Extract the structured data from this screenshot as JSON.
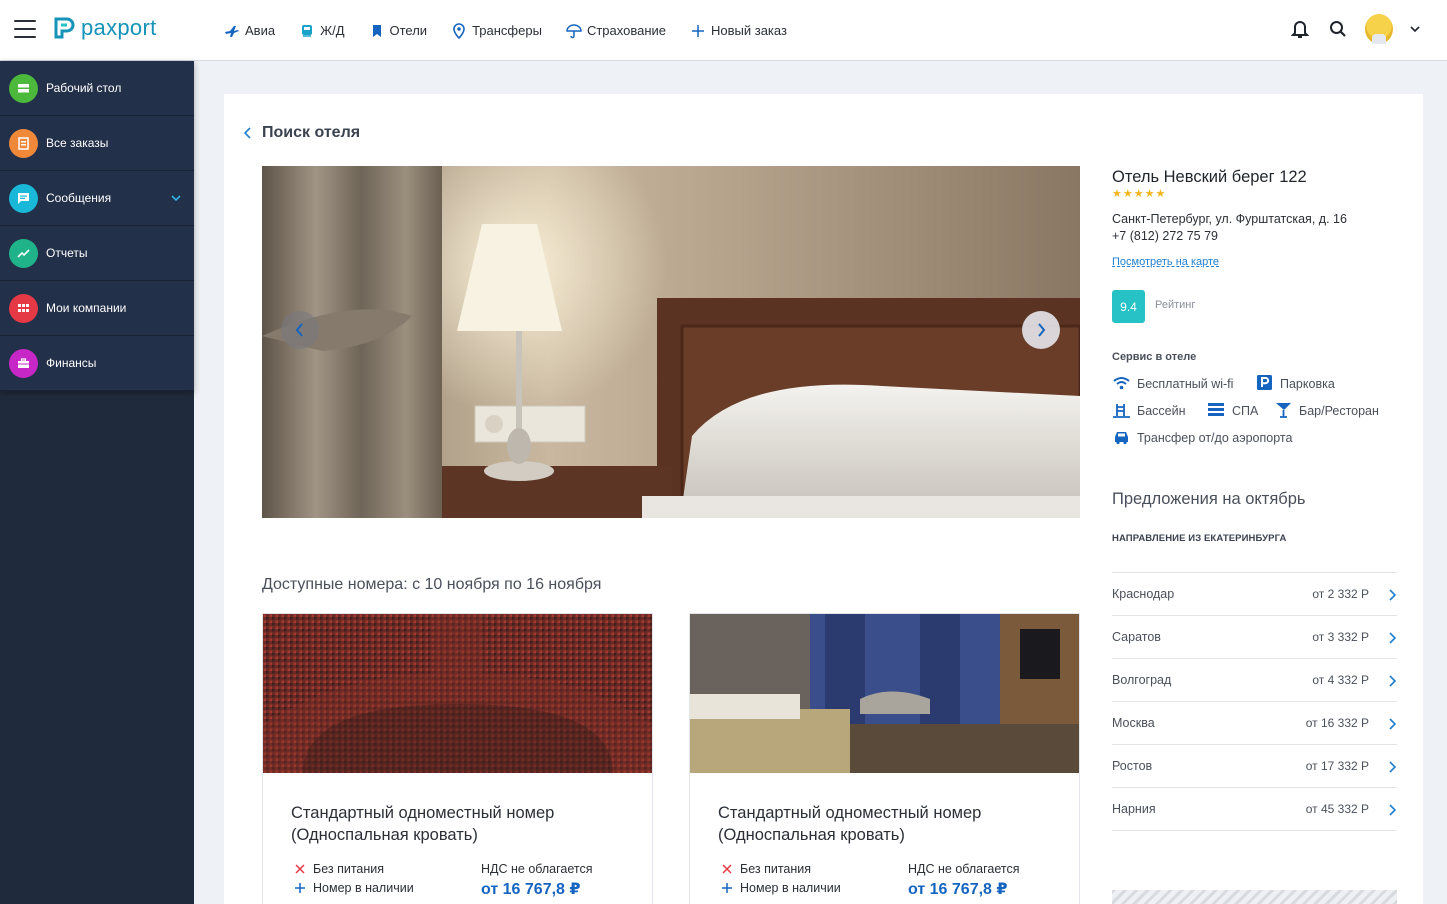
{
  "brand": {
    "name": "paxport",
    "accent": "#1593b8"
  },
  "topnav": [
    {
      "label": "Авиа",
      "icon": "plane-icon"
    },
    {
      "label": "Ж/Д",
      "icon": "train-icon"
    },
    {
      "label": "Отели",
      "icon": "bookmark-icon"
    },
    {
      "label": "Трансферы",
      "icon": "location-pin-icon"
    },
    {
      "label": "Страхование",
      "icon": "umbrella-icon"
    },
    {
      "label": "Новый заказ",
      "icon": "plus-icon"
    }
  ],
  "sidebar": {
    "items": [
      {
        "label": "Рабочий стол",
        "color": "#4cb83c",
        "icon": "desktop-icon"
      },
      {
        "label": "Все заказы",
        "color": "#f0883a",
        "icon": "orders-icon"
      },
      {
        "label": "Сообщения",
        "color": "#1ab8d8",
        "icon": "chat-icon"
      },
      {
        "label": "Отчеты",
        "color": "#20b38a",
        "icon": "chart-trend-icon"
      },
      {
        "label": "Мои компании",
        "color": "#e53945",
        "icon": "grid-icon"
      },
      {
        "label": "Финансы",
        "color": "#c727c7",
        "icon": "briefcase-icon"
      }
    ]
  },
  "page": {
    "back_label": "Поиск отеля",
    "rooms_title": "Доступные номера: с 10 ноября по 16 ноября"
  },
  "rooms": [
    {
      "name": "Стандартный одноместный номер (Односпальная кровать)",
      "feature_1": "Без питания",
      "feature_2": "Номер в наличии",
      "vat": "НДС не облагается",
      "price": "от 16 767,8 ₽"
    },
    {
      "name": "Стандартный одноместный номер (Односпальная кровать)",
      "feature_1": "Без питания",
      "feature_2": "Номер в наличии",
      "vat": "НДС не облагается",
      "price": "от 16 767,8 ₽"
    }
  ],
  "hotel": {
    "name": "Отель Невский берег 122",
    "stars": 5,
    "address": "Санкт-Петербург, ул. Фурштатская, д. 16",
    "phone": "+7 (812) 272 75 79",
    "map_link": "Посмотреть на карте",
    "rating": "9.4",
    "rating_label": "Рейтинг",
    "services_title": "Сервис в отеле",
    "services": [
      {
        "label": "Бесплатный wi-fi",
        "icon": "wifi-icon"
      },
      {
        "label": "Парковка",
        "icon": "parking-icon"
      },
      {
        "label": "Бассейн",
        "icon": "pool-icon"
      },
      {
        "label": "СПА",
        "icon": "spa-icon"
      },
      {
        "label": "Бар/Ресторан",
        "icon": "cocktail-icon"
      },
      {
        "label": "Трансфер от/до аэропорта",
        "icon": "car-icon"
      }
    ]
  },
  "offers": {
    "title": "Предложения на октябрь",
    "direction": "НАПРАВЛЕНИЕ ИЗ ЕКАТЕРИНБУРГА",
    "rows": [
      {
        "city": "Краснодар",
        "price": "от 2 332 Р"
      },
      {
        "city": "Саратов",
        "price": "от 3 332 Р"
      },
      {
        "city": "Волгоград",
        "price": "от 4 332 Р"
      },
      {
        "city": "Москва",
        "price": "от 16 332 Р"
      },
      {
        "city": "Ростов",
        "price": "от 17 332 Р"
      },
      {
        "city": "Нарния",
        "price": "от 45 332 Р"
      }
    ]
  }
}
